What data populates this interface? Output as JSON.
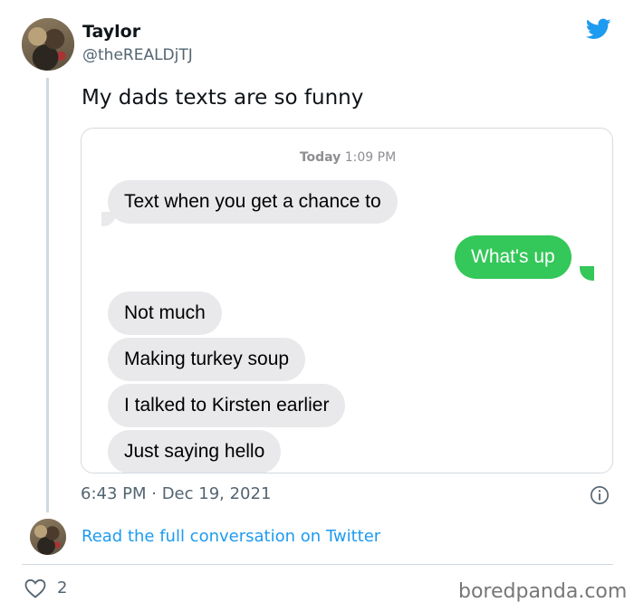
{
  "tweet": {
    "author_name": "Taylor",
    "author_handle": "@theREALDjTJ",
    "text": "My dads texts are so funny",
    "timestamp": "6:43 PM · Dec 19, 2021",
    "likes": "2",
    "read_more": "Read the full conversation on Twitter",
    "icons": [
      "twitter-bird-icon",
      "info-icon",
      "heart-icon"
    ]
  },
  "messages": {
    "time_day": "Today",
    "time_clock": "1:09 PM",
    "items": [
      {
        "text": "Text when you get a chance to",
        "direction": "incoming"
      },
      {
        "text": "What's up",
        "direction": "outgoing"
      },
      {
        "text": "Not much",
        "direction": "incoming"
      },
      {
        "text": "Making turkey soup",
        "direction": "incoming"
      },
      {
        "text": "I talked to Kirsten earlier",
        "direction": "incoming"
      },
      {
        "text": "Just saying hello",
        "direction": "incoming"
      }
    ]
  },
  "colors": {
    "twitter_blue": "#1d9bf0",
    "imessage_green": "#34c759",
    "incoming_gray": "#e9e9eb"
  },
  "watermark": "boredpanda.com"
}
